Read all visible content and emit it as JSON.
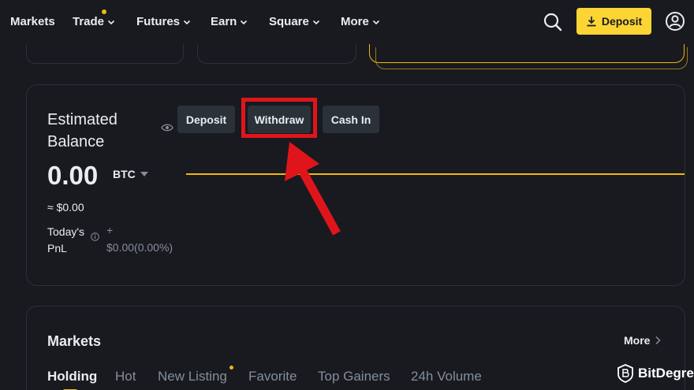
{
  "nav": {
    "items": [
      {
        "label": "Markets",
        "has_chevron": false,
        "dot": false
      },
      {
        "label": "Trade",
        "has_chevron": true,
        "dot": true
      },
      {
        "label": "Futures",
        "has_chevron": true,
        "dot": false
      },
      {
        "label": "Earn",
        "has_chevron": true,
        "dot": false
      },
      {
        "label": "Square",
        "has_chevron": true,
        "dot": false
      },
      {
        "label": "More",
        "has_chevron": true,
        "dot": false
      }
    ],
    "deposit_label": "Deposit",
    "icons": [
      "search-icon",
      "download-icon",
      "user-icon"
    ]
  },
  "balance": {
    "title": "Estimated Balance",
    "actions": [
      "Deposit",
      "Withdraw",
      "Cash In"
    ],
    "value": "0.00",
    "unit": "BTC",
    "fiat": "≈ $0.00",
    "pnl_label": "Today's PnL",
    "pnl_sign": "+",
    "pnl_value": "$0.00(0.00%)"
  },
  "markets": {
    "title": "Markets",
    "more_label": "More",
    "tabs": [
      "Holding",
      "Hot",
      "New Listing",
      "Favorite",
      "Top Gainers",
      "24h Volume"
    ],
    "active_tab": "Holding"
  },
  "watermark": {
    "text": "BitDegree"
  },
  "colors": {
    "background": "#181a20",
    "accent": "#fcd535",
    "border": "#2b3139",
    "annotation": "#e0151b",
    "muted": "#848e9c"
  }
}
